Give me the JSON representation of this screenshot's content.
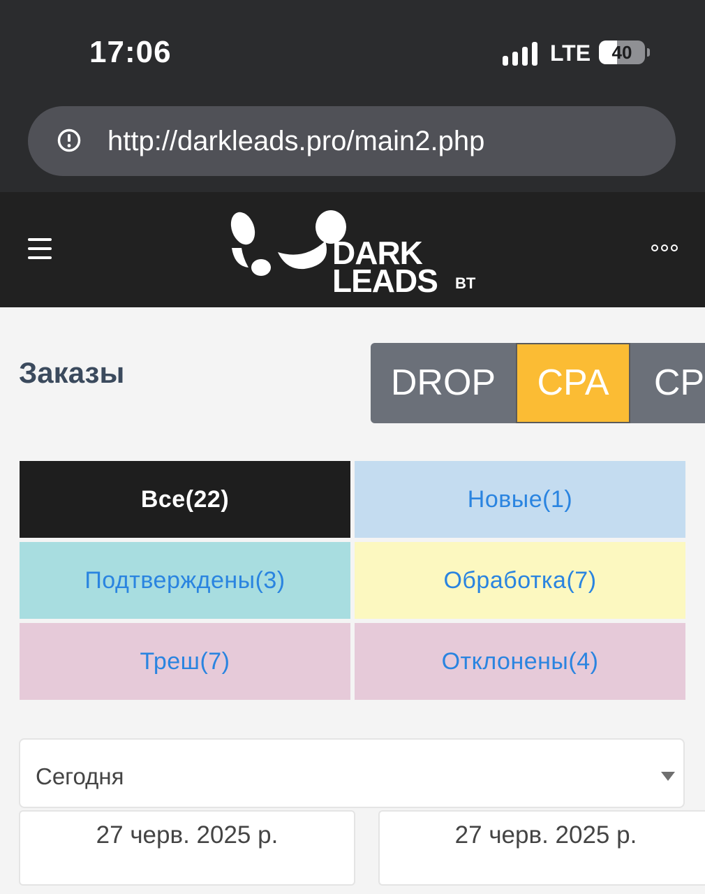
{
  "status_bar": {
    "time": "17:06",
    "network": "LTE",
    "battery": "40"
  },
  "browser": {
    "url": "http://darkleads.pro/main2.php"
  },
  "header": {
    "logo": {
      "line1": "DARK",
      "line2": "LEADS",
      "suffix": "BT"
    }
  },
  "page": {
    "title": "Заказы",
    "modes": [
      {
        "label": "DROP",
        "active": false
      },
      {
        "label": "CPA",
        "active": true
      },
      {
        "label": "CP",
        "active": false
      }
    ]
  },
  "status_tabs": [
    {
      "label": "Все(22)",
      "bg": "#1e1e1e",
      "color": "#ffffff",
      "active": true
    },
    {
      "label": "Новые(1)",
      "bg": "#c4dcf0",
      "color": "#2a84e0",
      "active": false
    },
    {
      "label": "Подтверждены(3)",
      "bg": "#a8dde0",
      "color": "#2a84e0",
      "active": false
    },
    {
      "label": "Обработка(7)",
      "bg": "#fcf8c0",
      "color": "#2a84e0",
      "active": false
    },
    {
      "label": "Треш(7)",
      "bg": "#e6cad9",
      "color": "#2a84e0",
      "active": false
    },
    {
      "label": "Отклонены(4)",
      "bg": "#e6cad9",
      "color": "#2a84e0",
      "active": false
    }
  ],
  "filters": {
    "period": "Сегодня",
    "date_from": "27 черв. 2025 р.",
    "date_to": "27 черв. 2025 р."
  },
  "colors": {
    "accent": "#fbbc34",
    "header_bg": "#212121",
    "title": "#3b4a5d",
    "link": "#2a84e0"
  }
}
